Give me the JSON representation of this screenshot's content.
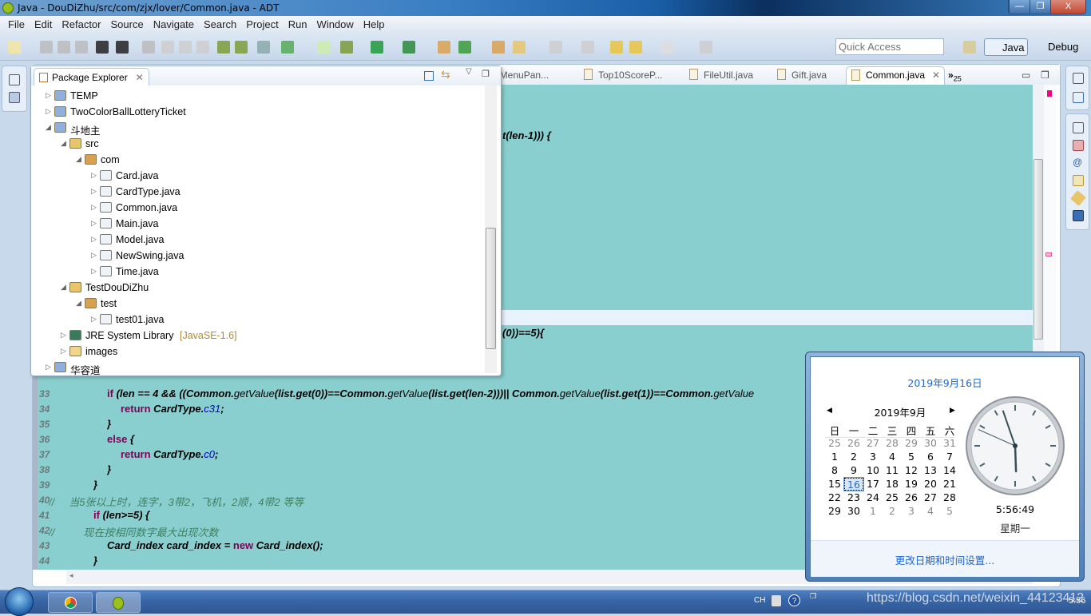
{
  "window": {
    "title": "Java - DouDiZhu/src/com/zjx/lover/Common.java - ADT",
    "minimize": "—",
    "restore": "❐",
    "close": "X"
  },
  "menu": [
    "File",
    "Edit",
    "Refactor",
    "Source",
    "Navigate",
    "Search",
    "Project",
    "Run",
    "Window",
    "Help"
  ],
  "toolbar": {
    "quick_access_placeholder": "Quick Access",
    "perspectives": [
      {
        "label": "Java",
        "active": true
      },
      {
        "label": "Debug",
        "active": false
      }
    ]
  },
  "package_explorer": {
    "title": "Package Explorer",
    "tree": [
      {
        "label": "TEMP",
        "depth": 0,
        "expanded": false,
        "icon": "project-error-icon"
      },
      {
        "label": "TwoColorBallLotteryTicket",
        "depth": 0,
        "expanded": false,
        "icon": "project-warning-icon"
      },
      {
        "label": "斗地主",
        "depth": 0,
        "expanded": true,
        "icon": "project-warning-icon"
      },
      {
        "label": "src",
        "depth": 1,
        "expanded": true,
        "icon": "source-folder-icon"
      },
      {
        "label": "com",
        "depth": 2,
        "expanded": true,
        "icon": "package-icon"
      },
      {
        "label": "Card.java",
        "depth": 3,
        "expanded": false,
        "icon": "java-file-warning-icon"
      },
      {
        "label": "CardType.java",
        "depth": 3,
        "expanded": false,
        "icon": "java-file-icon"
      },
      {
        "label": "Common.java",
        "depth": 3,
        "expanded": false,
        "icon": "java-file-warning-icon"
      },
      {
        "label": "Main.java",
        "depth": 3,
        "expanded": false,
        "icon": "java-file-warning-icon"
      },
      {
        "label": "Model.java",
        "depth": 3,
        "expanded": false,
        "icon": "java-file-icon"
      },
      {
        "label": "NewSwing.java",
        "depth": 3,
        "expanded": false,
        "icon": "java-file-warning-icon"
      },
      {
        "label": "Time.java",
        "depth": 3,
        "expanded": false,
        "icon": "java-file-warning-icon"
      },
      {
        "label": "TestDouDiZhu",
        "depth": 1,
        "expanded": true,
        "icon": "source-folder-icon"
      },
      {
        "label": "test",
        "depth": 2,
        "expanded": true,
        "icon": "package-icon"
      },
      {
        "label": "test01.java",
        "depth": 3,
        "expanded": false,
        "icon": "java-file-icon"
      },
      {
        "label": "JRE System Library",
        "suffix": "[JavaSE-1.6]",
        "depth": 1,
        "expanded": false,
        "icon": "library-icon"
      },
      {
        "label": "images",
        "depth": 1,
        "expanded": false,
        "icon": "folder-icon"
      },
      {
        "label": "华容道",
        "depth": 0,
        "expanded": false,
        "icon": "project-error-icon"
      }
    ]
  },
  "editor": {
    "tabs": [
      {
        "label": "oMenuPan..."
      },
      {
        "label": "Top10ScoreP..."
      },
      {
        "label": "FileUtil.java"
      },
      {
        "label": "Gift.java"
      },
      {
        "label": "Common.java",
        "active": true
      }
    ],
    "overflow": "»",
    "overflow_count": "25",
    "partial_lines": [
      {
        "tokens": [
          {
            "t": "t(len-1))) {",
            "s": "b"
          }
        ]
      },
      {
        "tokens": [
          {
            "t": "(0))==5){",
            "s": "b"
          }
        ]
      }
    ],
    "lines": [
      {
        "no": "33",
        "indent": 2,
        "tokens": [
          {
            "t": "if",
            "s": "k"
          },
          {
            "t": " (len == 4 && ((Common.",
            "s": "b"
          },
          {
            "t": "getValue",
            "s": "n"
          },
          {
            "t": "(list.get(0))==Common.",
            "s": "b"
          },
          {
            "t": "getValue",
            "s": "n"
          },
          {
            "t": "(list.get(len-2)))|| Common.",
            "s": "b"
          },
          {
            "t": "getValue",
            "s": "n"
          },
          {
            "t": "(list.get(1))==Common.",
            "s": "b"
          },
          {
            "t": "getValue",
            "s": "n"
          }
        ]
      },
      {
        "no": "34",
        "indent": 3,
        "tokens": [
          {
            "t": "return",
            "s": "k"
          },
          {
            "t": " CardType.",
            "s": "b"
          },
          {
            "t": "c31",
            "s": "f"
          },
          {
            "t": ";",
            "s": "b"
          }
        ]
      },
      {
        "no": "35",
        "indent": 2,
        "tokens": [
          {
            "t": "}",
            "s": "b"
          }
        ]
      },
      {
        "no": "36",
        "indent": 2,
        "tokens": [
          {
            "t": "else",
            "s": "k"
          },
          {
            "t": " {",
            "s": "b"
          }
        ]
      },
      {
        "no": "37",
        "indent": 3,
        "tokens": [
          {
            "t": "return",
            "s": "k"
          },
          {
            "t": " CardType.",
            "s": "b"
          },
          {
            "t": "c0",
            "s": "f"
          },
          {
            "t": ";",
            "s": "b"
          }
        ]
      },
      {
        "no": "38",
        "indent": 2,
        "tokens": [
          {
            "t": "}",
            "s": "b"
          }
        ]
      },
      {
        "no": "39",
        "indent": 1,
        "tokens": [
          {
            "t": "}",
            "s": "b"
          }
        ]
      },
      {
        "no": "40",
        "indent": 0,
        "tokens": [
          {
            "t": "//     当5张以上时，连字，3带2，飞机，2顺，4带2 等等",
            "s": "c"
          }
        ]
      },
      {
        "no": "41",
        "indent": 1,
        "tokens": [
          {
            "t": "if",
            "s": "k"
          },
          {
            "t": " (len>=5) {",
            "s": "b"
          }
        ]
      },
      {
        "no": "42",
        "indent": 0,
        "tokens": [
          {
            "t": "//          现在按相同数字最大出现次数",
            "s": "c"
          }
        ]
      },
      {
        "no": "43",
        "indent": 2,
        "tokens": [
          {
            "t": "Card_index card_index = ",
            "s": "b"
          },
          {
            "t": "new",
            "s": "k"
          },
          {
            "t": " Card_index();",
            "s": "b"
          }
        ]
      },
      {
        "no": "44",
        "indent": 1,
        "tokens": [
          {
            "t": "}",
            "s": "b"
          }
        ]
      }
    ]
  },
  "calendar": {
    "header_date": "2019年9月16日",
    "month_label": "2019年9月",
    "weekdays": [
      "日",
      "一",
      "二",
      "三",
      "四",
      "五",
      "六"
    ],
    "weeks": [
      [
        [
          "25",
          1
        ],
        [
          "26",
          1
        ],
        [
          "27",
          1
        ],
        [
          "28",
          1
        ],
        [
          "29",
          1
        ],
        [
          "30",
          1
        ],
        [
          "31",
          1
        ]
      ],
      [
        [
          "1",
          0
        ],
        [
          "2",
          0
        ],
        [
          "3",
          0
        ],
        [
          "4",
          0
        ],
        [
          "5",
          0
        ],
        [
          "6",
          0
        ],
        [
          "7",
          0
        ]
      ],
      [
        [
          "8",
          0
        ],
        [
          "9",
          0
        ],
        [
          "10",
          0
        ],
        [
          "11",
          0
        ],
        [
          "12",
          0
        ],
        [
          "13",
          0
        ],
        [
          "14",
          0
        ]
      ],
      [
        [
          "15",
          0
        ],
        [
          "16",
          2
        ],
        [
          "17",
          0
        ],
        [
          "18",
          0
        ],
        [
          "19",
          0
        ],
        [
          "20",
          0
        ],
        [
          "21",
          0
        ]
      ],
      [
        [
          "22",
          0
        ],
        [
          "23",
          0
        ],
        [
          "24",
          0
        ],
        [
          "25",
          0
        ],
        [
          "26",
          0
        ],
        [
          "27",
          0
        ],
        [
          "28",
          0
        ]
      ],
      [
        [
          "29",
          0
        ],
        [
          "30",
          0
        ],
        [
          "1",
          1
        ],
        [
          "2",
          1
        ],
        [
          "3",
          1
        ],
        [
          "4",
          1
        ],
        [
          "5",
          1
        ]
      ]
    ],
    "time": "5:56:49",
    "weekday": "星期一",
    "clock": {
      "hour": 5,
      "minute": 56,
      "second": 49
    },
    "settings_link": "更改日期和时间设置..."
  },
  "taskbar": {
    "ime": "CH",
    "clock": "5:56",
    "watermark": "https://blog.csdn.net/weixin_44123412"
  },
  "colors": {
    "editor_bg": "#8acfcf",
    "keyword": "#7f0055",
    "field": "#0000c0",
    "comment": "#3f7f5f",
    "link": "#2266cc"
  }
}
